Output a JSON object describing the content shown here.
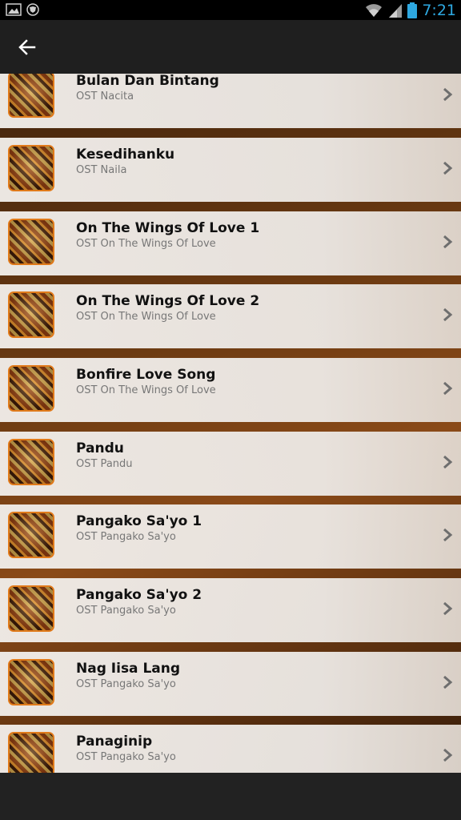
{
  "status_bar": {
    "time": "7:21",
    "icons": [
      "image-icon",
      "shield-icon",
      "wifi-icon",
      "signal-icon",
      "battery-icon"
    ],
    "clock_color": "#2ea8e0"
  },
  "app_bar": {
    "back_icon": "back-arrow-icon"
  },
  "songs": [
    {
      "title": "Bulan Dan Bintang",
      "subtitle": "OST Nacita"
    },
    {
      "title": "Kesedihanku",
      "subtitle": "OST Naila"
    },
    {
      "title": "On The Wings Of Love 1",
      "subtitle": "OST On The Wings Of Love"
    },
    {
      "title": "On The Wings Of Love 2",
      "subtitle": "OST On The Wings Of Love"
    },
    {
      "title": "Bonfire Love Song",
      "subtitle": "OST On The Wings Of Love"
    },
    {
      "title": "Pandu",
      "subtitle": "OST Pandu"
    },
    {
      "title": "Pangako Sa'yo 1",
      "subtitle": "OST Pangako Sa'yo"
    },
    {
      "title": "Pangako Sa'yo 2",
      "subtitle": "OST Pangako Sa'yo"
    },
    {
      "title": "Nag Iisa Lang",
      "subtitle": "OST Pangako Sa'yo"
    },
    {
      "title": "Panaginip",
      "subtitle": "OST Pangako Sa'yo"
    }
  ],
  "item_icons": {
    "thumbnail": "album-art-icon",
    "chevron": "chevron-right-icon"
  },
  "colors": {
    "accent": "#e07a1a",
    "app_bar": "#1f1f1f"
  }
}
